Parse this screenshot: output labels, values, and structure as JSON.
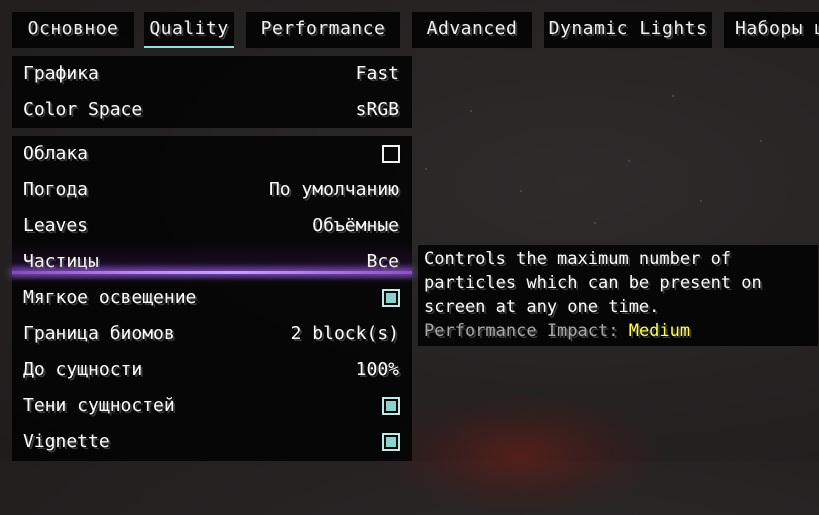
{
  "tabs": [
    {
      "label": "Основное",
      "active": false
    },
    {
      "label": "Quality",
      "active": true
    },
    {
      "label": "Performance",
      "active": false
    },
    {
      "label": "Advanced",
      "active": false
    },
    {
      "label": "Dynamic Lights",
      "active": false
    },
    {
      "label": "Наборы ш",
      "active": false
    }
  ],
  "group1": [
    {
      "label": "Графика",
      "value": "Fast"
    },
    {
      "label": "Color Space",
      "value": "sRGB"
    }
  ],
  "group2": [
    {
      "label": "Облака",
      "type": "checkbox",
      "checked": false
    },
    {
      "label": "Погода",
      "value": "По умолчанию"
    },
    {
      "label": "Leaves",
      "value": "Объёмные"
    },
    {
      "label": "Частицы",
      "value": "Все",
      "hovered": true
    },
    {
      "label": "Мягкое освещение",
      "type": "checkbox",
      "checked": true
    },
    {
      "label": "Граница биомов",
      "value": "2 block(s)"
    },
    {
      "label": "До сущности",
      "value": "100%"
    },
    {
      "label": "Тени сущностей",
      "type": "checkbox",
      "checked": true
    },
    {
      "label": "Vignette",
      "type": "checkbox",
      "checked": true
    }
  ],
  "tooltip": {
    "lines": [
      "Controls the maximum number of",
      "particles which can be present on",
      "screen at any one time."
    ],
    "impact_label": "Performance Impact: ",
    "impact_value": "Medium"
  },
  "colors": {
    "accent": "#9be0d6",
    "checkbox_fill": "#88d4cb",
    "hover_glow": "#b488f0",
    "impact_medium": "#ffff55"
  }
}
